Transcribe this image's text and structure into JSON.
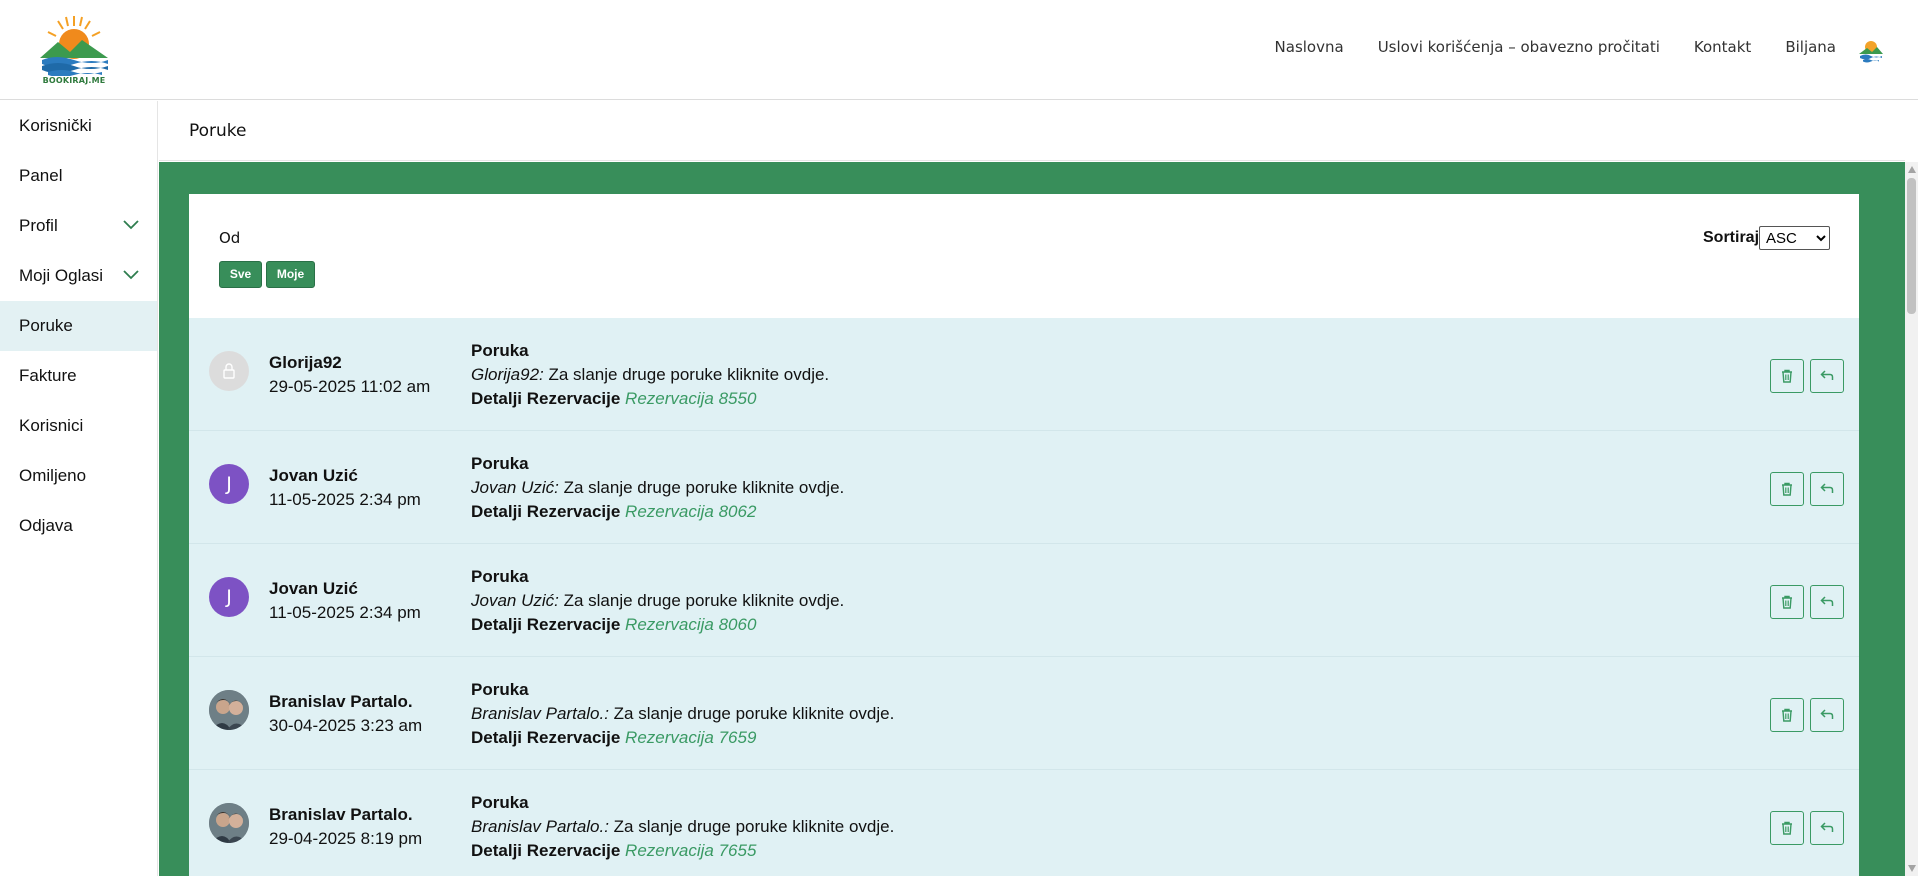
{
  "header": {
    "logo_text": "BOOKIRAJ.ME",
    "nav": [
      "Naslovna",
      "Uslovi korišćenja – obavezno pročitati",
      "Kontakt",
      "Biljana"
    ]
  },
  "sidebar": {
    "items": [
      {
        "label": "Korisnički",
        "icon": ""
      },
      {
        "label": "Panel",
        "icon": ""
      },
      {
        "label": "Profil",
        "icon": "chevron-down-icon"
      },
      {
        "label": "Moji Oglasi",
        "icon": "chevron-down-icon"
      },
      {
        "label": "Poruke",
        "icon": "",
        "active": true
      },
      {
        "label": "Fakture",
        "icon": ""
      },
      {
        "label": "Korisnici",
        "icon": ""
      },
      {
        "label": "Omiljeno",
        "icon": ""
      },
      {
        "label": "Odjava",
        "icon": ""
      }
    ]
  },
  "page": {
    "title": "Poruke",
    "filter_label": "Od",
    "filter_buttons": [
      "Sve",
      "Moje"
    ],
    "sort_label": "Sortiraj",
    "sort_value": "ASC"
  },
  "messages": [
    {
      "sender": "Glorija92",
      "date": "29-05-2025 11:02 am",
      "heading": "Poruka",
      "body_author": "Glorija92:",
      "body_text": " Za slanje druge poruke kliknite ovdje.",
      "details_label": "Detalji Rezervacije",
      "reservation": "Rezervacija 8550",
      "avatar": "blank",
      "avatar_letter": ""
    },
    {
      "sender": "Jovan Uzić",
      "date": "11-05-2025 2:34 pm",
      "heading": "Poruka",
      "body_author": "Jovan Uzić:",
      "body_text": " Za slanje druge poruke kliknite ovdje.",
      "details_label": "Detalji Rezervacije",
      "reservation": "Rezervacija 8062",
      "avatar": "letter",
      "avatar_letter": "J"
    },
    {
      "sender": "Jovan Uzić",
      "date": "11-05-2025 2:34 pm",
      "heading": "Poruka",
      "body_author": "Jovan Uzić:",
      "body_text": " Za slanje druge poruke kliknite ovdje.",
      "details_label": "Detalji Rezervacije",
      "reservation": "Rezervacija 8060",
      "avatar": "letter",
      "avatar_letter": "J"
    },
    {
      "sender": "Branislav Partalo.",
      "date": "30-04-2025 3:23 am",
      "heading": "Poruka",
      "body_author": "Branislav Partalo.:",
      "body_text": " Za slanje druge poruke kliknite ovdje.",
      "details_label": "Detalji Rezervacije",
      "reservation": "Rezervacija 7659",
      "avatar": "photo",
      "avatar_letter": ""
    },
    {
      "sender": "Branislav Partalo.",
      "date": "29-04-2025 8:19 pm",
      "heading": "Poruka",
      "body_author": "Branislav Partalo.:",
      "body_text": " Za slanje druge poruke kliknite ovdje.",
      "details_label": "Detalji Rezervacije",
      "reservation": "Rezervacija 7655",
      "avatar": "photo",
      "avatar_letter": ""
    }
  ],
  "colors": {
    "brand_green": "#388e5a",
    "link_green": "#3a9a64",
    "row_bg": "#e0f1f4",
    "avatar_purple": "#7d52c4"
  }
}
